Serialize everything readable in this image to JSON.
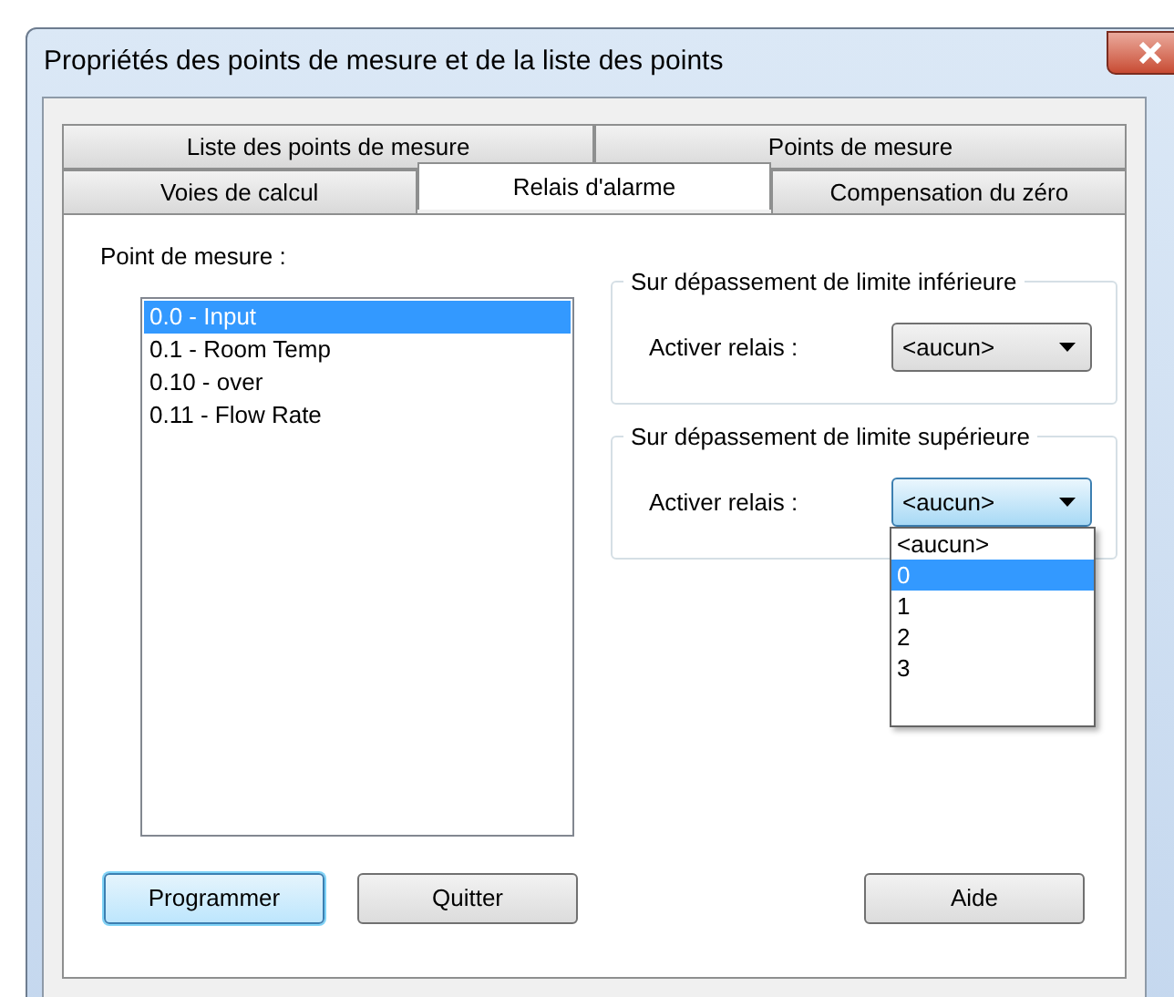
{
  "window": {
    "title": "Propriétés des points de mesure et de la liste des points"
  },
  "tab_rows": [
    [
      {
        "label": "Liste des points de mesure",
        "selected": false
      },
      {
        "label": "Points de mesure",
        "selected": false
      }
    ],
    [
      {
        "label": "Voies de calcul",
        "selected": false
      },
      {
        "label": "Relais d'alarme",
        "selected": true
      },
      {
        "label": "Compensation du zéro",
        "selected": false
      }
    ]
  ],
  "point_label": "Point de mesure :",
  "points": [
    {
      "label": "0.0 - Input",
      "selected": true
    },
    {
      "label": "0.1 - Room Temp",
      "selected": false
    },
    {
      "label": "0.10 - over",
      "selected": false
    },
    {
      "label": "0.11 - Flow Rate",
      "selected": false
    }
  ],
  "groups": [
    {
      "title": "Sur dépassement de limite inférieure",
      "label": "Activer relais :",
      "value": "<aucun>",
      "expanded": false
    },
    {
      "title": "Sur dépassement de limite supérieure",
      "label": "Activer relais :",
      "value": "<aucun>",
      "expanded": true,
      "options": [
        {
          "label": "<aucun>",
          "highlighted": false
        },
        {
          "label": "0",
          "highlighted": true
        },
        {
          "label": "1",
          "highlighted": false
        },
        {
          "label": "2",
          "highlighted": false
        },
        {
          "label": "3",
          "highlighted": false
        }
      ]
    }
  ],
  "buttons": [
    {
      "label": "Programmer",
      "default": true
    },
    {
      "label": "Quitter",
      "default": false
    },
    {
      "label": "Aide",
      "default": false
    }
  ]
}
